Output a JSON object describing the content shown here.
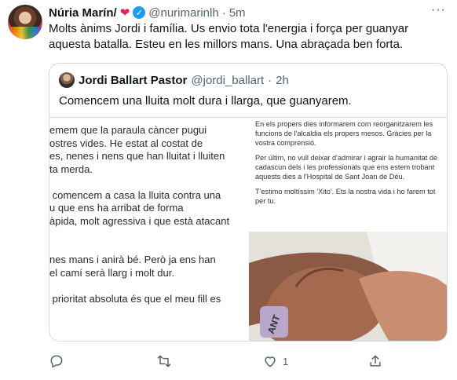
{
  "tweet": {
    "display_name": "Núria Marín/",
    "heart": "❤",
    "handle": "@nurimarinlh",
    "separator": "·",
    "time": "5m",
    "more_label": "···",
    "text": "Molts ànims Jordi i família. Us envio tota l'energia i força per guanyar aquesta batalla. Esteu en les millors mans. Una abraçada ben forta."
  },
  "quoted_tweet": {
    "display_name": "Jordi Ballart Pastor",
    "handle": "@jordi_ballart",
    "separator": "·",
    "time": "2h",
    "text": "Comencem una lluita molt dura i llarga, que guanyarem.",
    "image_left_lines": [
      "emem que la paraula càncer pugui",
      "ostres vides. He estat al costat de",
      "es, nenes i nens que han lluitat i lluiten",
      "ta merda.",
      "",
      " comencem a casa la lluita contra una",
      "u que ens ha arribat de forma",
      "àpida, molt agressiva i que està atacant",
      "",
      "",
      "nes mans i anirà bé. Però ja ens han",
      "el camí serà llarg i molt dur.",
      "",
      " prioritat absoluta és que el meu fill es"
    ],
    "image_right_paragraphs": [
      "En els propers dies informarem com reorganitzarem les funcions de l'alcaldia els propers mesos. Gràcies per la vostra comprensió.",
      "Per últim, no vull deixar d'admirar i agrair la humanitat de cadascun dels i les professionals que ens estem trobant aquests dies a l'Hospital de Sant Joan de Déu.",
      "T'estimo moltíssim 'Xito'. Ets la nostra vida i ho farem tot per tu."
    ],
    "photo_wristband_text": "ANT"
  },
  "actions": {
    "reply_count": "",
    "retweet_count": "",
    "like_count": "1",
    "share_count": ""
  },
  "colors": {
    "accent": "#1d9bf0",
    "heart": "#e0245e",
    "secondary_text": "#536471",
    "border": "#cfd9de"
  }
}
